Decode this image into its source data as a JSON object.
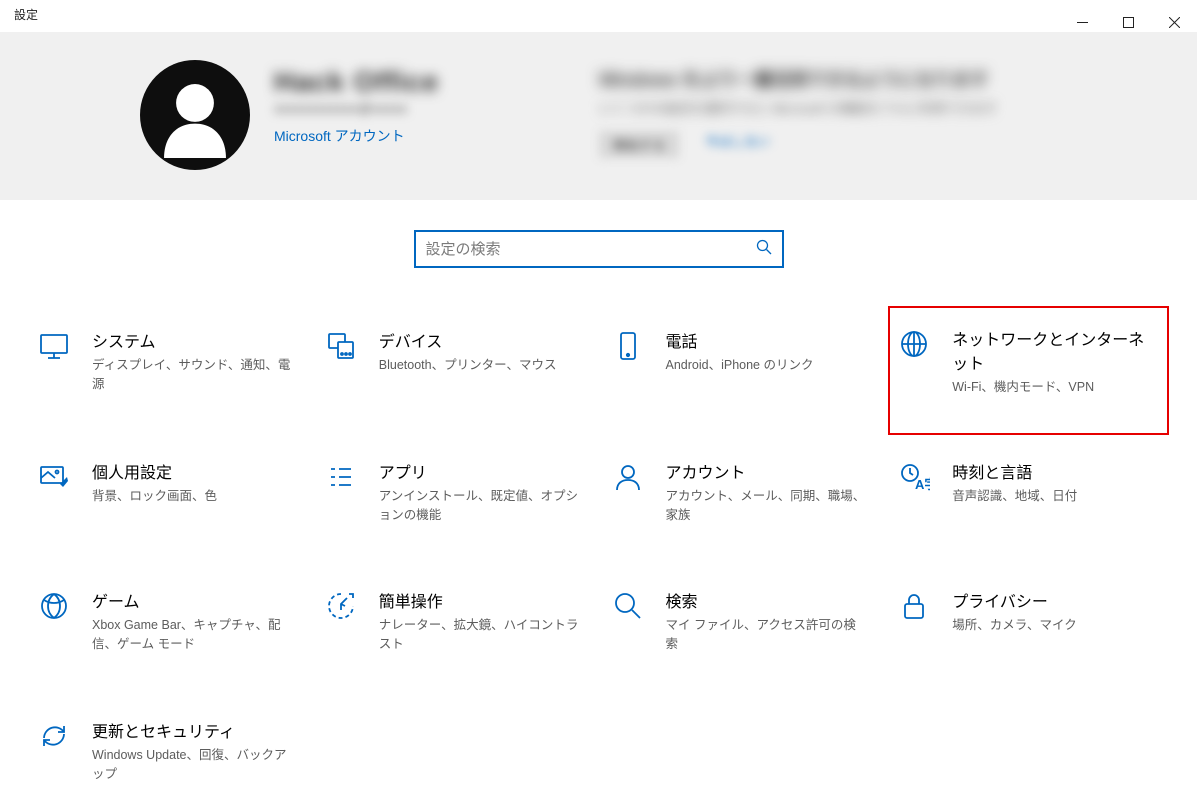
{
  "window": {
    "title": "設定"
  },
  "header": {
    "username_blur": "Hack Office",
    "email_blur": "xxxxxxxxxxxx@xxxxx",
    "ms_account_link": "Microsoft アカウント",
    "right_title_blur": "Windows をより一層活用できるようになります",
    "right_sub_blur": "いくつかの設定を選択すると Microsoft の機能をフルに利用できます",
    "right_btn_blur": "開始する",
    "right_link_blur": "今はしない"
  },
  "search": {
    "placeholder": "設定の検索"
  },
  "tiles": {
    "system": {
      "title": "システム",
      "desc": "ディスプレイ、サウンド、通知、電源"
    },
    "devices": {
      "title": "デバイス",
      "desc": "Bluetooth、プリンター、マウス"
    },
    "phone": {
      "title": "電話",
      "desc": "Android、iPhone のリンク"
    },
    "network": {
      "title": "ネットワークとインターネット",
      "desc": "Wi-Fi、機内モード、VPN"
    },
    "personalize": {
      "title": "個人用設定",
      "desc": "背景、ロック画面、色"
    },
    "apps": {
      "title": "アプリ",
      "desc": "アンインストール、既定値、オプションの機能"
    },
    "accounts": {
      "title": "アカウント",
      "desc": "アカウント、メール、同期、職場、家族"
    },
    "time": {
      "title": "時刻と言語",
      "desc": "音声認識、地域、日付"
    },
    "gaming": {
      "title": "ゲーム",
      "desc": "Xbox Game Bar、キャプチャ、配信、ゲーム モード"
    },
    "ease": {
      "title": "簡単操作",
      "desc": "ナレーター、拡大鏡、ハイコントラスト"
    },
    "searchcat": {
      "title": "検索",
      "desc": "マイ ファイル、アクセス許可の検索"
    },
    "privacy": {
      "title": "プライバシー",
      "desc": "場所、カメラ、マイク"
    },
    "update": {
      "title": "更新とセキュリティ",
      "desc": "Windows Update、回復、バックアップ"
    }
  }
}
